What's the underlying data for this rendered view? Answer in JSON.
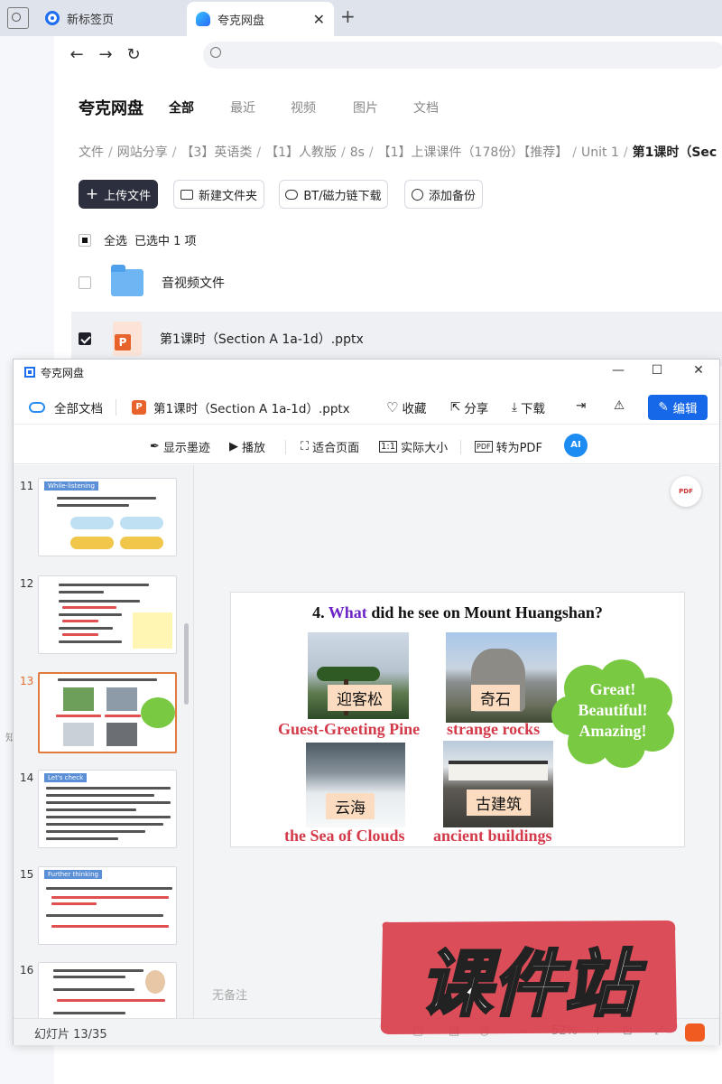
{
  "browser": {
    "tabs": [
      {
        "label": "新标签页"
      },
      {
        "label": "夸克网盘"
      }
    ]
  },
  "drive": {
    "logo": "夸克网盘",
    "nav_tabs": [
      "全部",
      "最近",
      "视频",
      "图片",
      "文档"
    ],
    "breadcrumb": [
      "文件",
      "网站分享",
      "【3】英语类",
      "【1】人教版",
      "8s",
      "【1】上课课件（178份）【推荐】",
      "Unit 1",
      "第1课时（Sec"
    ],
    "actions": {
      "upload": "上传文件",
      "new_folder": "新建文件夹",
      "bt": "BT/磁力链下载",
      "backup": "添加备份"
    },
    "selection": {
      "select_all": "全选",
      "selected_text": "已选中 1 项"
    },
    "files": [
      {
        "name": "音视频文件",
        "type": "folder",
        "checked": false
      },
      {
        "name": "第1课时（Section A 1a-1d）.pptx",
        "type": "pptx",
        "checked": true
      }
    ]
  },
  "viewer": {
    "title": "夸克网盘",
    "top": {
      "all_docs": "全部文档",
      "filename": "第1课时（Section A 1a-1d）.pptx",
      "favorite": "收藏",
      "share": "分享",
      "download": "下载",
      "edit": "编辑"
    },
    "tools": {
      "ink": "显示墨迹",
      "play": "播放",
      "fit": "适合页面",
      "actual": "实际大小",
      "to_pdf": "转为PDF",
      "ai": "AI"
    },
    "thumbs": [
      {
        "num": "11",
        "heading": "While-listening"
      },
      {
        "num": "12",
        "heading": ""
      },
      {
        "num": "13",
        "heading": "",
        "active": true
      },
      {
        "num": "14",
        "heading": "Let's check"
      },
      {
        "num": "15",
        "heading": "Further thinking"
      },
      {
        "num": "16",
        "heading": ""
      }
    ],
    "slide": {
      "number": "4.",
      "what": "What",
      "question_rest": "did he see on Mount Huangshan?",
      "items": [
        {
          "tag": "迎客松",
          "caption": "Guest-Greeting Pine"
        },
        {
          "tag": "奇石",
          "caption": "strange rocks"
        },
        {
          "tag": "云海",
          "caption": "the Sea of Clouds"
        },
        {
          "tag": "古建筑",
          "caption": "ancient buildings"
        }
      ],
      "bubble": [
        "Great!",
        "Beautiful!",
        "Amazing!"
      ]
    },
    "notes": "无备注",
    "status": {
      "slide_count": "幻灯片 13/35",
      "zoom": "52%"
    }
  },
  "watermark": "课件站",
  "colors": {
    "accent": "#1768e8",
    "caption_red": "#d33a4a",
    "what_purple": "#6b23c7",
    "bubble_green": "#7ac943",
    "watermark_red": "#d8404c"
  }
}
